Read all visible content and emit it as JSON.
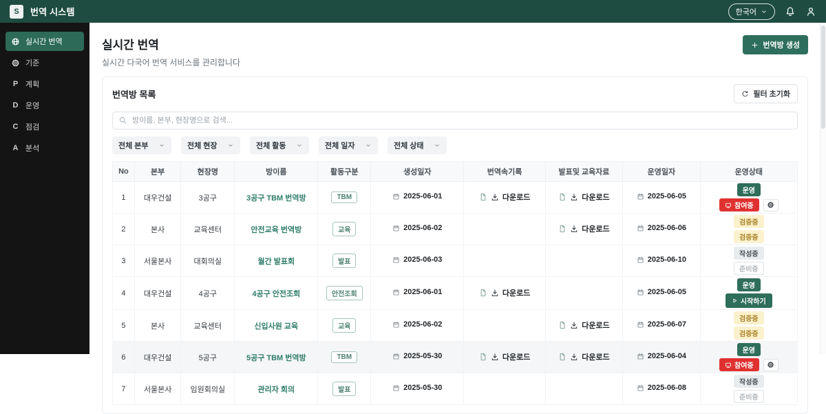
{
  "header": {
    "logo": "S",
    "title": "번역 시스템",
    "language": "한국어"
  },
  "sidebar": {
    "items": [
      {
        "key": "realtime-translation",
        "icon": "globe",
        "label": "실시간 번역",
        "active": true
      },
      {
        "key": "standard",
        "icon": "gear",
        "label": "기준",
        "active": false
      },
      {
        "key": "plan",
        "icon": "P",
        "label": "계획",
        "active": false
      },
      {
        "key": "operation",
        "icon": "D",
        "label": "운영",
        "active": false
      },
      {
        "key": "inspection",
        "icon": "C",
        "label": "점검",
        "active": false
      },
      {
        "key": "analysis",
        "icon": "A",
        "label": "분석",
        "active": false
      }
    ]
  },
  "page": {
    "title": "실시간 번역",
    "subtitle": "실시간 다국어 번역 서비스를 관리합니다",
    "create_button": "번역방 생성"
  },
  "panel": {
    "title": "번역방 목록",
    "reset_button": "필터 초기화",
    "search_placeholder": "방이름, 본부, 현장명으로 검색...",
    "filters": [
      "전체 본부",
      "전체 현장",
      "전체 활동",
      "전체 일자",
      "전체 상태"
    ]
  },
  "table": {
    "columns": [
      "No",
      "본부",
      "현장명",
      "방이름",
      "활동구분",
      "생성일자",
      "번역속기록",
      "발표및 교육자료",
      "운영일자",
      "운영상태"
    ],
    "download_label": "다운로드",
    "rows": [
      {
        "no": "1",
        "hq": "대우건설",
        "site": "3공구",
        "room": "3공구 TBM 번역방",
        "activity": "TBM",
        "created": "2025-06-01",
        "transcript": true,
        "materials": true,
        "op_date": "2025-06-05",
        "highlight": false,
        "status": [
          {
            "style": "solid",
            "text": "운영"
          },
          {
            "style": "live",
            "text": "참여중",
            "gear": true
          }
        ]
      },
      {
        "no": "2",
        "hq": "본사",
        "site": "교육센터",
        "room": "안전교육 번역방",
        "activity": "교육",
        "created": "2025-06-02",
        "transcript": false,
        "materials": true,
        "op_date": "2025-06-06",
        "highlight": false,
        "status": [
          {
            "style": "yellow",
            "text": "검증중"
          },
          {
            "style": "yellow",
            "text": "검증중"
          }
        ]
      },
      {
        "no": "3",
        "hq": "서울본사",
        "site": "대회의실",
        "room": "월간 발표회",
        "activity": "발표",
        "created": "2025-06-03",
        "transcript": false,
        "materials": false,
        "op_date": "2025-06-10",
        "highlight": false,
        "status": [
          {
            "style": "gray",
            "text": "작성중"
          },
          {
            "style": "outline",
            "text": "준비중"
          }
        ]
      },
      {
        "no": "4",
        "hq": "대우건설",
        "site": "4공구",
        "room": "4공구 안전조회",
        "activity": "안전조회",
        "created": "2025-06-01",
        "transcript": true,
        "materials": false,
        "op_date": "2025-06-05",
        "highlight": false,
        "status": [
          {
            "style": "solid",
            "text": "운영"
          },
          {
            "style": "start",
            "text": "시작하기"
          }
        ]
      },
      {
        "no": "5",
        "hq": "본사",
        "site": "교육센터",
        "room": "신입사원 교육",
        "activity": "교육",
        "created": "2025-06-02",
        "transcript": false,
        "materials": true,
        "op_date": "2025-06-07",
        "highlight": false,
        "status": [
          {
            "style": "yellow",
            "text": "검증중"
          },
          {
            "style": "yellow",
            "text": "검증중"
          }
        ]
      },
      {
        "no": "6",
        "hq": "대우건설",
        "site": "5공구",
        "room": "5공구 TBM 번역방",
        "activity": "TBM",
        "created": "2025-05-30",
        "transcript": true,
        "materials": true,
        "op_date": "2025-06-04",
        "highlight": true,
        "status": [
          {
            "style": "solid",
            "text": "운영"
          },
          {
            "style": "live",
            "text": "참여중",
            "gear": true
          }
        ]
      },
      {
        "no": "7",
        "hq": "서울본사",
        "site": "임원회의실",
        "room": "관리자 회의",
        "activity": "발표",
        "created": "2025-05-30",
        "transcript": false,
        "materials": false,
        "op_date": "2025-06-08",
        "highlight": false,
        "status": [
          {
            "style": "gray",
            "text": "작성중"
          },
          {
            "style": "outline",
            "text": "준비중"
          }
        ]
      }
    ]
  },
  "icons": {
    "logo": "app-logo",
    "language_chevron": "chevron-down-icon",
    "bell": "bell-icon",
    "user": "user-icon",
    "active_nav": "globe-icon",
    "settings_nav": "gear-icon",
    "search": "search-icon",
    "reset": "refresh-icon",
    "create": "plus-icon",
    "date": "calendar-icon",
    "file": "document-icon",
    "download": "download-icon",
    "join": "monitor-icon",
    "start": "play-icon",
    "row_settings": "gear-icon"
  },
  "colors": {
    "header_bg": "#1E4C40",
    "sidebar_bg": "#141414",
    "active_item_bg": "#2D6A58",
    "accent": "#2E6E5C",
    "link": "#2F7D6A",
    "operating_badge": "#2F6E5B",
    "live_red": "#E03131",
    "verify_bg": "#FCF1CD",
    "verify_text": "#A8842A",
    "draft_bg": "#E9ECEF",
    "border": "#E9ECEF"
  }
}
